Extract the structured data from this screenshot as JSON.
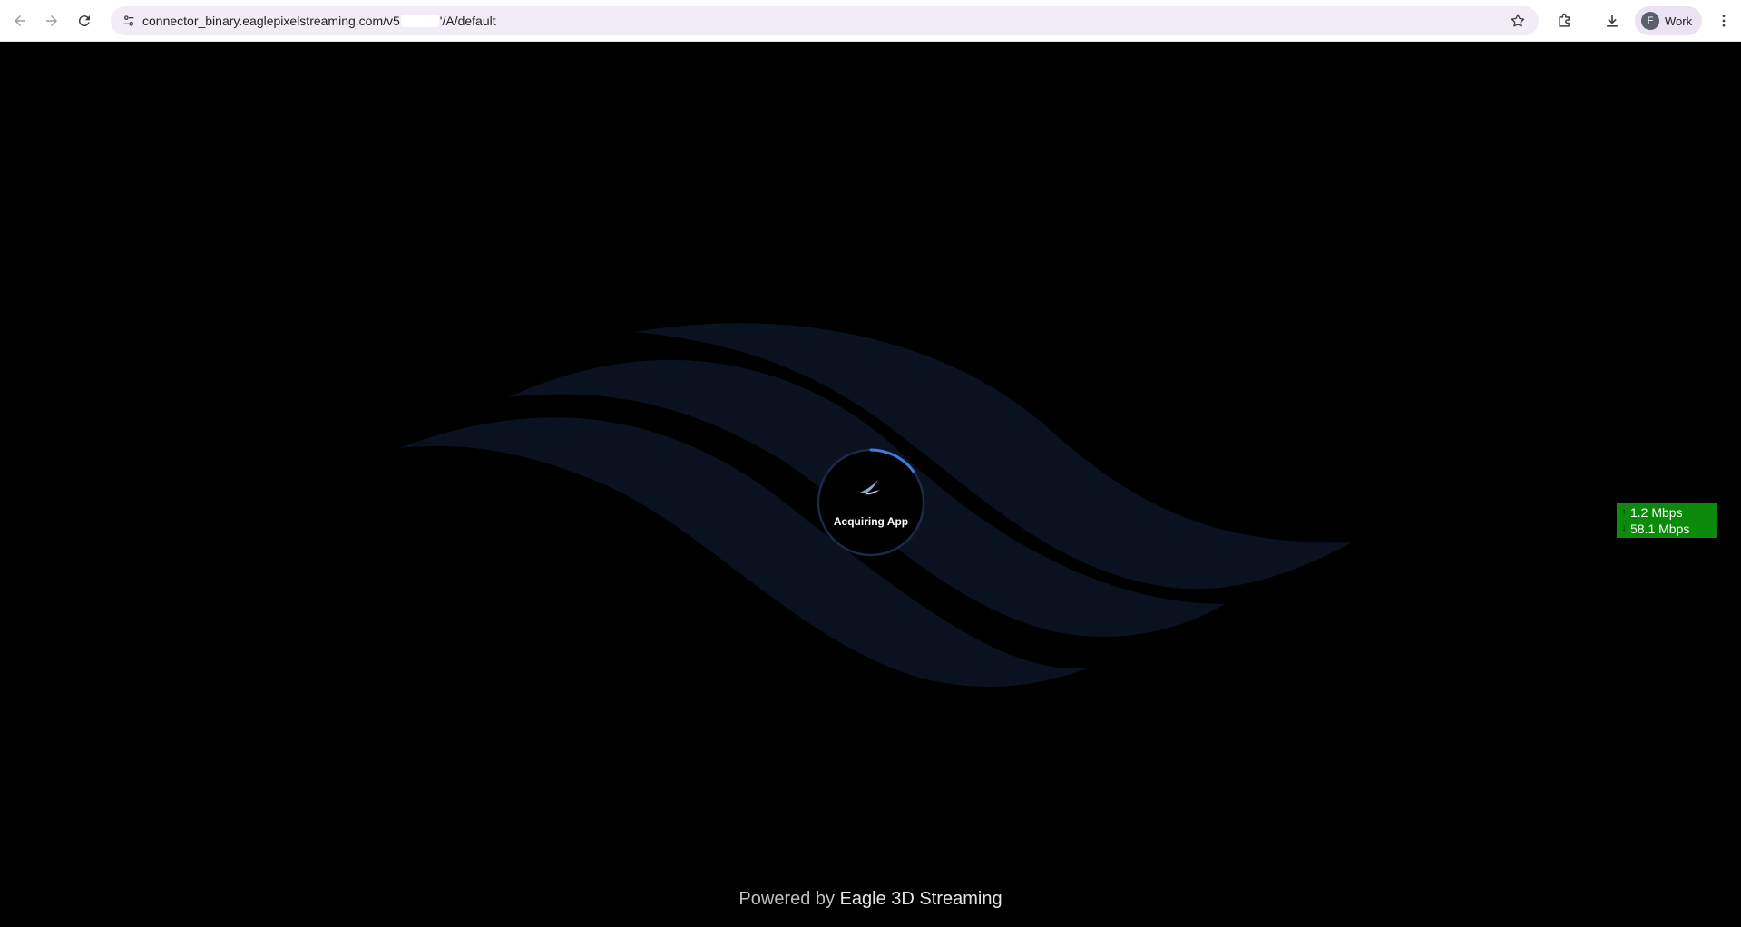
{
  "browser": {
    "url_prefix": "connector_binary.eaglepixelstreaming.com/v5",
    "url_suffix": "'/A/default",
    "profile_initial": "F",
    "profile_label": "Work"
  },
  "loader": {
    "status": "Acquiring App",
    "progress_fraction": 0.15,
    "accent": "#3f7be0"
  },
  "stats": {
    "up_arrow": "↑",
    "up_rate": "1.2 Mbps",
    "down_arrow": "↓",
    "down_rate": "58.1 Mbps",
    "background": "#0b8a0b"
  },
  "footer": {
    "powered_prefix": "Powered by ",
    "brand": "Eagle 3D Streaming"
  },
  "icons": {
    "back": "arrow-left-icon",
    "forward": "arrow-right-icon",
    "reload": "reload-icon",
    "site_info": "tune-icon",
    "bookmark": "star-icon",
    "extensions": "puzzle-icon",
    "downloads": "download-icon",
    "menu": "kebab-menu-icon"
  }
}
